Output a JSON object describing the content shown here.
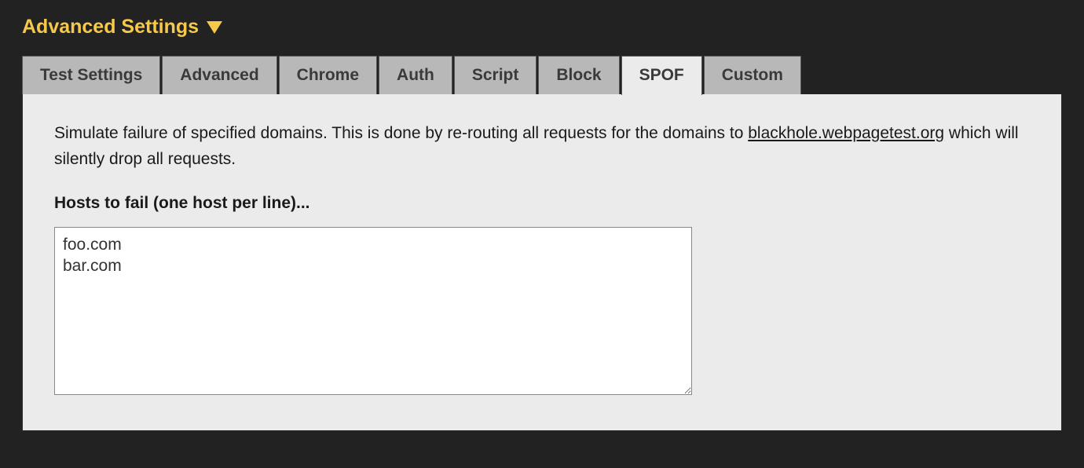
{
  "header": {
    "title": "Advanced Settings"
  },
  "tabs": [
    {
      "label": "Test Settings",
      "active": false
    },
    {
      "label": "Advanced",
      "active": false
    },
    {
      "label": "Chrome",
      "active": false
    },
    {
      "label": "Auth",
      "active": false
    },
    {
      "label": "Script",
      "active": false
    },
    {
      "label": "Block",
      "active": false
    },
    {
      "label": "SPOF",
      "active": true
    },
    {
      "label": "Custom",
      "active": false
    }
  ],
  "spof": {
    "description_before_link": "Simulate failure of specified domains. This is done by re-routing all requests for the domains to ",
    "link_text": "blackhole.webpagetest.org",
    "description_after_link": " which will silently drop all requests.",
    "hosts_label": "Hosts to fail (one host per line)...",
    "hosts_value": "foo.com\nbar.com"
  }
}
